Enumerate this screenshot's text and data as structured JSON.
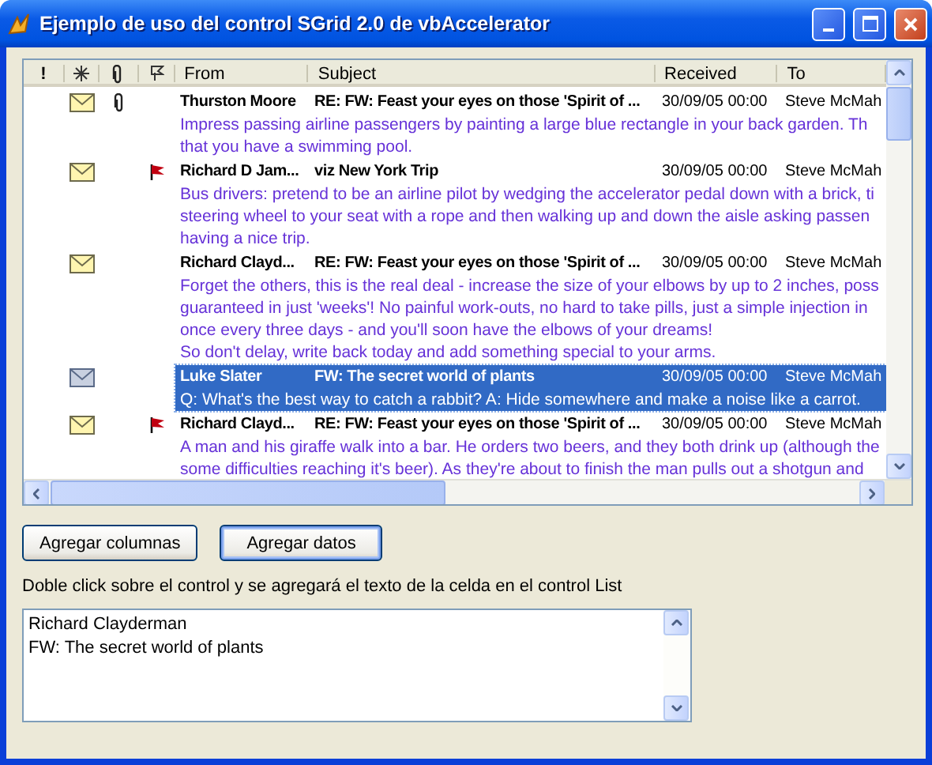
{
  "window": {
    "title": "Ejemplo de uso del control SGrid 2.0 de vbAccelerator"
  },
  "grid": {
    "columns": [
      {
        "kind": "text",
        "label": "!"
      },
      {
        "kind": "star"
      },
      {
        "kind": "paperclip"
      },
      {
        "kind": "flag"
      },
      {
        "kind": "text",
        "label": "From"
      },
      {
        "kind": "text",
        "label": "Subject"
      },
      {
        "kind": "text",
        "label": "Received"
      },
      {
        "kind": "text",
        "label": "To"
      }
    ],
    "rows": [
      {
        "from": "Thurston Moore",
        "subject": "RE: FW: Feast your eyes on those 'Spirit of ...",
        "received": "30/09/05 00:00",
        "to": "Steve McMah",
        "attachment": true,
        "flagged": false,
        "selected": false,
        "preview": [
          "Impress passing airline passengers by painting a large blue rectangle in your back garden.  Th",
          "that you have a swimming pool."
        ]
      },
      {
        "from": "Richard D Jam...",
        "subject": "viz New York Trip",
        "received": "30/09/05 00:00",
        "to": "Steve McMah",
        "attachment": false,
        "flagged": true,
        "selected": false,
        "preview": [
          "Bus drivers: pretend to be an airline pilot by wedging the accelerator pedal down with a brick, ti",
          "steering wheel to your seat with a rope and then walking up and down the aisle asking passen",
          "having a nice trip."
        ]
      },
      {
        "from": "Richard Clayd...",
        "subject": "RE: FW: Feast your eyes on those 'Spirit of ...",
        "received": "30/09/05 00:00",
        "to": "Steve McMah",
        "attachment": false,
        "flagged": false,
        "selected": false,
        "preview": [
          "Forget the others, this is the real deal - increase the size of your elbows by up to 2 inches, poss",
          "guaranteed in just 'weeks'!  No painful work-outs, no hard to take pills, just a simple injection in",
          "once every three days - and you'll soon have the elbows of your dreams!",
          "So don't delay, write back today and add something special to your arms."
        ]
      },
      {
        "from": "Luke Slater",
        "subject": "FW: The secret world of plants",
        "received": "30/09/05 00:00",
        "to": "Steve McMah",
        "attachment": false,
        "flagged": false,
        "selected": true,
        "preview": [
          "Q: What's the best way to catch a rabbit? A: Hide somewhere and make a noise like a carrot."
        ]
      },
      {
        "from": "Richard Clayd...",
        "subject": "RE: FW: Feast your eyes on those 'Spirit of ...",
        "received": "30/09/05 00:00",
        "to": "Steve McMah",
        "attachment": false,
        "flagged": true,
        "selected": false,
        "preview": [
          "A man and his giraffe walk into a bar.  He orders two beers, and they both drink up (although the",
          "some difficulties reaching it's beer).  As they're about to finish the man pulls out a shotgun and"
        ]
      }
    ]
  },
  "buttons": [
    {
      "label": "Agregar columnas",
      "default": false
    },
    {
      "label": "Agregar datos",
      "default": true
    }
  ],
  "hint": "Doble click sobre el control y se agregará el texto de la celda en el control List",
  "list": {
    "items": [
      "Richard Clayderman",
      "FW: The secret world of plants"
    ]
  }
}
